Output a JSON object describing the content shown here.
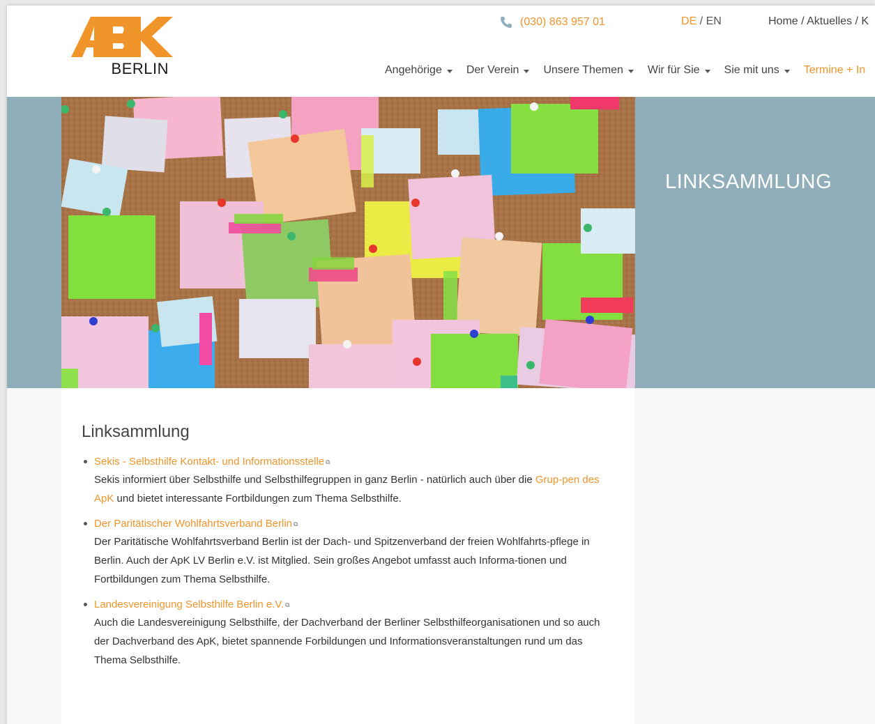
{
  "colors": {
    "accent": "#f0952a",
    "hero_bg": "#8faeb9",
    "text": "#333333"
  },
  "header": {
    "logo_city": "BERLIN",
    "phone": "(030) 863 957 01",
    "lang_active": "DE",
    "lang_sep": " / ",
    "lang_other": "EN",
    "breadcrumb": "Home / Aktuelles / K"
  },
  "nav": {
    "items": [
      {
        "label": "Angehörige"
      },
      {
        "label": "Der Verein"
      },
      {
        "label": "Unsere Themen"
      },
      {
        "label": "Wir für Sie"
      },
      {
        "label": "Sie mit uns"
      }
    ],
    "accent_item": "Termine + In"
  },
  "hero": {
    "title": "LINKSAMMLUNG"
  },
  "content": {
    "title": "Linksammlung",
    "links": [
      {
        "title": "Sekis - Selbsthilfe Kontakt- und Informationsstelle",
        "desc_before": "Sekis informiert über Selbsthilfe und Selbsthilfegruppen in ganz Berlin - natürlich auch über die ",
        "desc_link": "Grup-pen des ApK",
        "desc_after": "  und bietet interessante Fortbildungen zum Thema Selbsthilfe."
      },
      {
        "title": "Der Paritätischer Wohlfahrtsverband Berlin",
        "desc": "Der Paritätische Wohlfahrtsverband Berlin ist der Dach- und Spitzenverband der freien Wohlfahrts-pflege in Berlin. Auch der ApK LV Berlin e.V. ist Mitglied. Sein großes Angebot umfasst auch Informa-tionen und Fortbildungen zum Thema Selbsthilfe."
      },
      {
        "title": "Landesvereinigung Selbsthilfe Berlin e.V.",
        "desc": "Auch die Landesvereinigung Selbsthilfe, der Dachverband der Berliner Selbsthilfeorganisationen und so auch der Dachverband des ApK, bietet spannende Forbildungen und Informationsveranstaltungen rund um das Thema Selbsthilfe."
      }
    ]
  }
}
